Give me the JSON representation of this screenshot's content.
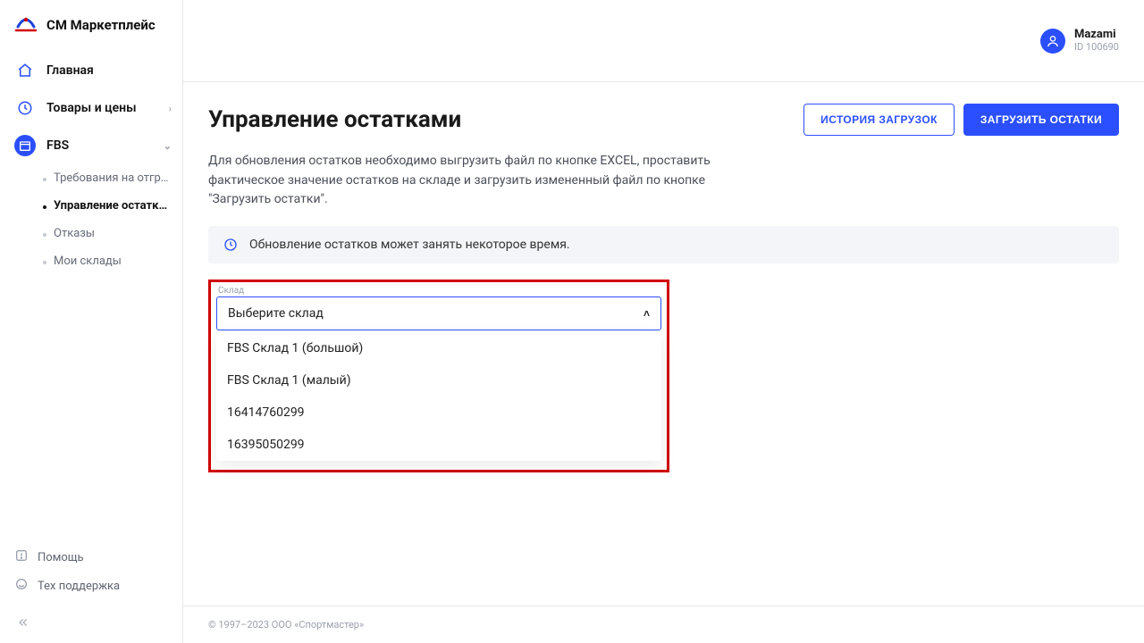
{
  "brand": {
    "name": "СМ Маркетплейс"
  },
  "user": {
    "name": "Mazami",
    "id_label": "ID 100690"
  },
  "nav": {
    "home": "Главная",
    "products": "Товары и цены",
    "fbs": "FBS",
    "sub": {
      "shipments": "Требования на отгру...",
      "stock": "Управление остатками",
      "refusals": "Отказы",
      "warehouses": "Мои склады"
    }
  },
  "sidebar_bottom": {
    "help": "Помощь",
    "support": "Тех поддержка"
  },
  "page": {
    "title": "Управление остатками",
    "actions": {
      "history": "ИСТОРИЯ ЗАГРУЗОК",
      "upload": "ЗАГРУЗИТЬ ОСТАТКИ"
    },
    "description": "Для обновления остатков необходимо выгрузить файл по кнопке EXCEL, проставить фактическое значение остатков на складе и загрузить измененный файл по кнопке \"Загрузить остатки\".",
    "info": "Обновление остатков может занять некоторое время."
  },
  "select": {
    "label": "Склад",
    "placeholder": "Выберите склад",
    "options": [
      "FBS Склад 1 (большой)",
      "FBS Склад 1 (малый)",
      "16414760299",
      "16395050299"
    ]
  },
  "footer": "© 1997–2023 ООО «Спортмастер»"
}
